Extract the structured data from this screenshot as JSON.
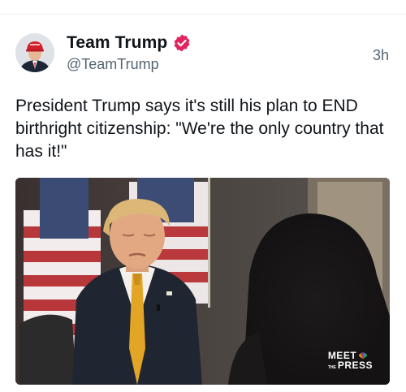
{
  "post": {
    "display_name": "Team Trump",
    "handle": "@TeamTrump",
    "timestamp": "3h",
    "verified_icon": "verified-badge-icon",
    "text": "President Trump says it's still his plan to END birthright citizenship: \"We're the only country that has it!\""
  },
  "media": {
    "logo_line1": "MEET",
    "logo_the": "THE",
    "logo_line2": "PRESS"
  },
  "colors": {
    "verified_badge": "#e0245e",
    "handle_text": "#536471",
    "tie": "#e3a526"
  }
}
